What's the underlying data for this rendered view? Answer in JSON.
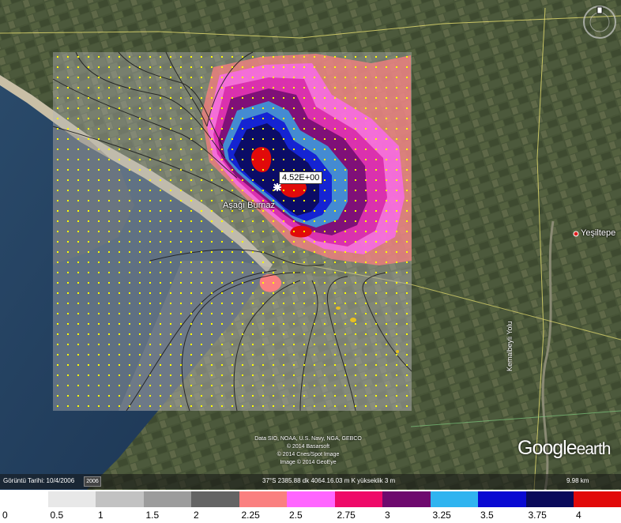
{
  "map": {
    "peak_value_label": "4.52E+00",
    "places": {
      "town": "Aşağı Burnaz",
      "east_village": "Yeşiltepe"
    },
    "road_label": "Kemalbeyli Yolu",
    "credits": [
      "Data SIO, NOAA, U.S. Navy, NGA, GEBCO",
      "© 2014 Basarsoft",
      "© 2014 Cnes/Spot Image",
      "Image © 2014 GeoEye"
    ],
    "logo": {
      "main": "Google",
      "suffix": "earth"
    },
    "status": {
      "imagery_date": "Görüntü Tarihi: 10/4/2006",
      "coordinates": "37°S 2385.88 dk 4064.16.03 m K yükseklik 3 m",
      "eye_alt": "9.98 km",
      "play_label": "2006"
    },
    "grid_color": "#ffff00"
  },
  "legend": {
    "items": [
      {
        "label": "0",
        "color": "#ffffff"
      },
      {
        "label": "0.5",
        "color": "#e8e8e8"
      },
      {
        "label": "1",
        "color": "#c2c2c2"
      },
      {
        "label": "1.5",
        "color": "#9c9c9c"
      },
      {
        "label": "2",
        "color": "#646464"
      },
      {
        "label": "2.25",
        "color": "#fa8080"
      },
      {
        "label": "2.5",
        "color": "#ff66ff"
      },
      {
        "label": "2.75",
        "color": "#ee0a68"
      },
      {
        "label": "3",
        "color": "#6e0a6e"
      },
      {
        "label": "3.25",
        "color": "#30b4f0"
      },
      {
        "label": "3.5",
        "color": "#0a0ad2"
      },
      {
        "label": "3.75",
        "color": "#0a0a5a"
      },
      {
        "label": "4",
        "color": "#e10a0a"
      }
    ]
  }
}
